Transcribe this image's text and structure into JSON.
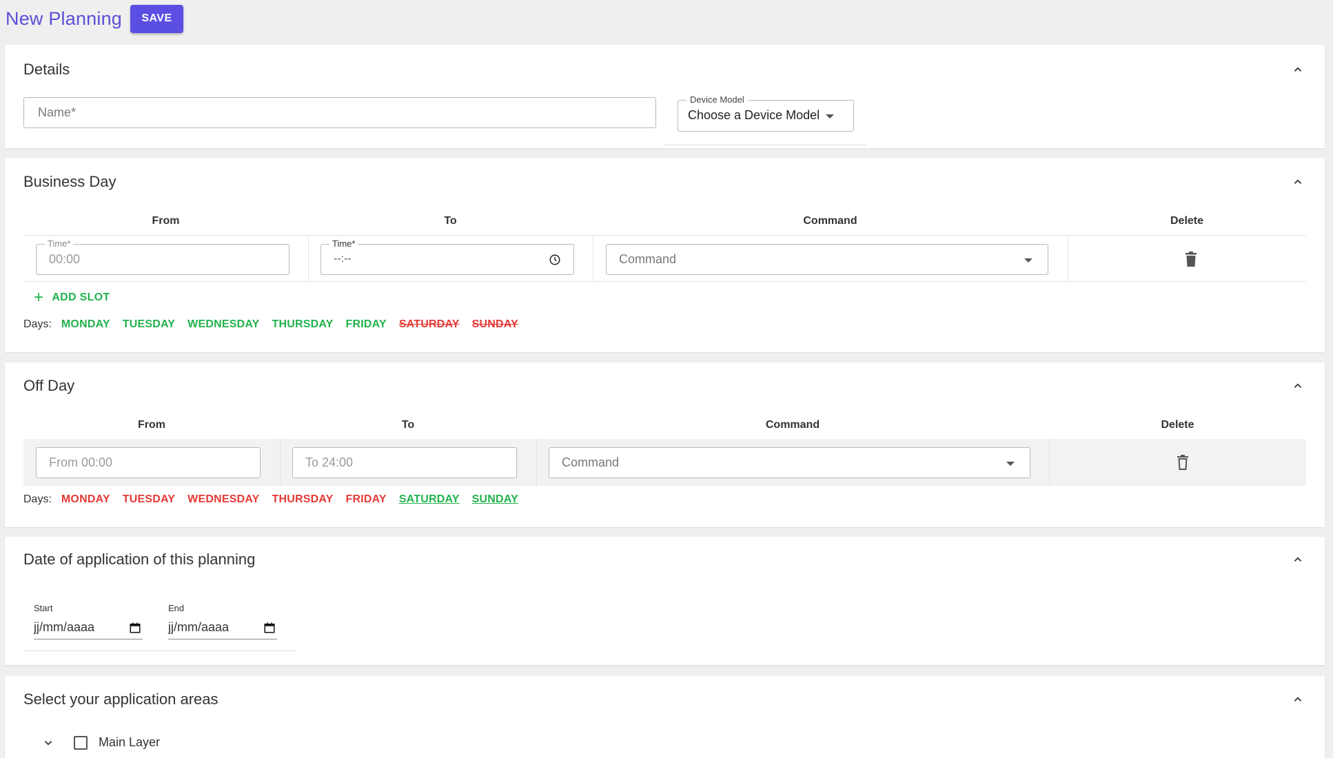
{
  "header": {
    "title": "New Planning",
    "save_label": "SAVE"
  },
  "details": {
    "title": "Details",
    "name_placeholder": "Name*",
    "device_model": {
      "legend": "Device Model",
      "value": "Choose a Device Model"
    }
  },
  "business_day": {
    "title": "Business Day",
    "columns": {
      "from": "From",
      "to": "To",
      "command": "Command",
      "delete": "Delete"
    },
    "slot": {
      "from_legend": "Time*",
      "from_value": "00:00",
      "to_legend": "Time*",
      "to_value": "--:--",
      "command_placeholder": "Command"
    },
    "add_slot_label": "ADD SLOT",
    "days_label": "Days:",
    "days": [
      {
        "label": "MONDAY",
        "active": true
      },
      {
        "label": "TUESDAY",
        "active": true
      },
      {
        "label": "WEDNESDAY",
        "active": true
      },
      {
        "label": "THURSDAY",
        "active": true
      },
      {
        "label": "FRIDAY",
        "active": true
      },
      {
        "label": "SATURDAY",
        "active": false
      },
      {
        "label": "SUNDAY",
        "active": false
      }
    ]
  },
  "off_day": {
    "title": "Off Day",
    "columns": {
      "from": "From",
      "to": "To",
      "command": "Command",
      "delete": "Delete"
    },
    "slot": {
      "from_value": "From 00:00",
      "to_value": "To 24:00",
      "command_placeholder": "Command"
    },
    "days_label": "Days:",
    "days": [
      {
        "label": "MONDAY",
        "active": false
      },
      {
        "label": "TUESDAY",
        "active": false
      },
      {
        "label": "WEDNESDAY",
        "active": false
      },
      {
        "label": "THURSDAY",
        "active": false
      },
      {
        "label": "FRIDAY",
        "active": false
      },
      {
        "label": "SATURDAY",
        "active": true
      },
      {
        "label": "SUNDAY",
        "active": true
      }
    ]
  },
  "date_application": {
    "title": "Date of application of this planning",
    "start_label": "Start",
    "start_value": "jj/mm/aaaa",
    "end_label": "End",
    "end_value": "jj/mm/aaaa"
  },
  "areas": {
    "title": "Select your application areas",
    "tree": [
      {
        "label": "Main Layer",
        "checked": false,
        "expanded": true
      }
    ]
  },
  "colors": {
    "accent": "#5b4ee3",
    "active_day": "#22b24c",
    "inactive_day": "#e53935"
  },
  "icons": {
    "collapse": "chevron-up-icon",
    "select": "caret-down-icon",
    "clock": "clock-icon",
    "delete": "trash-icon",
    "add": "plus-icon",
    "calendar": "calendar-icon",
    "expand": "chevron-down-icon",
    "checkbox": "checkbox-icon"
  }
}
